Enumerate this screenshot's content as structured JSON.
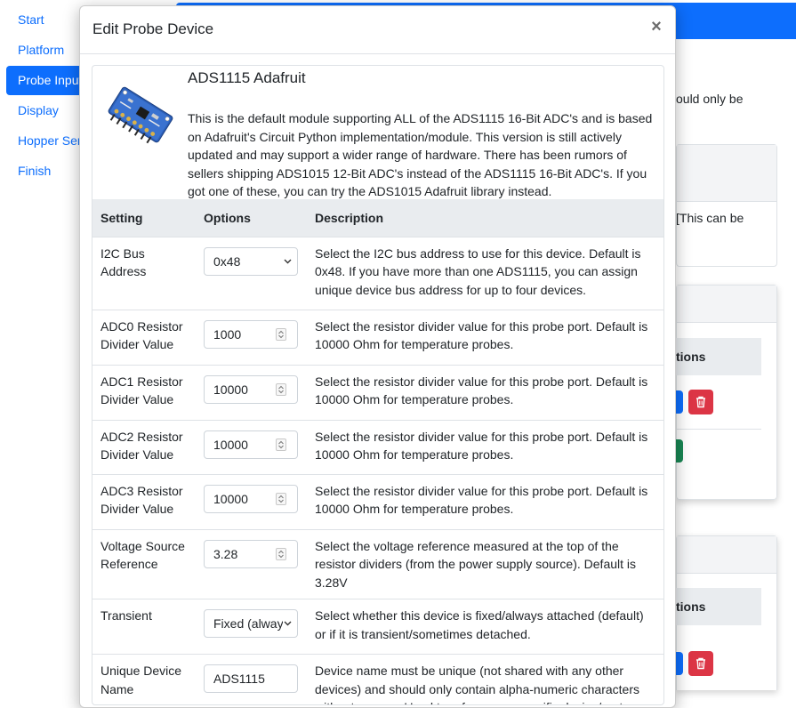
{
  "sidebar": {
    "items": [
      {
        "label": "Start",
        "active": false
      },
      {
        "label": "Platform",
        "active": false
      },
      {
        "label": "Probe Input",
        "active": true
      },
      {
        "label": "Display",
        "active": false
      },
      {
        "label": "Hopper Sensor",
        "active": false
      },
      {
        "label": "Finish",
        "active": false
      }
    ]
  },
  "background": {
    "partial_text_1": "ould only be",
    "partial_text_2": "[This can be",
    "table_header_partial": "tions"
  },
  "modal": {
    "title": "Edit Probe Device",
    "close_glyph": "×",
    "module": {
      "name": "ADS1115 Adafruit",
      "description": "This is the default module supporting ALL of the ADS1115 16-Bit ADC's and is based on Adafruit's Circuit Python implementation/module. This version is still actively updated and may support a wider range of hardware. There has been rumors of sellers shipping ADS1015 12-Bit ADC's instead of the ADS1115 16-Bit ADC's. If you got one of these, you can try the ADS1015 Adafruit library instead."
    },
    "table": {
      "headers": {
        "setting": "Setting",
        "options": "Options",
        "description": "Description"
      },
      "rows": [
        {
          "setting": "I2C Bus Address",
          "value": "0x48",
          "control": "select",
          "description": "Select the I2C bus address to use for this device. Default is 0x48. If you have more than one ADS1115, you can assign unique device bus address for up to four devices."
        },
        {
          "setting": "ADC0 Resistor Divider Value",
          "value": "1000",
          "control": "number",
          "description": "Select the resistor divider value for this probe port. Default is 10000 Ohm for temperature probes."
        },
        {
          "setting": "ADC1 Resistor Divider Value",
          "value": "10000",
          "control": "number",
          "description": "Select the resistor divider value for this probe port. Default is 10000 Ohm for temperature probes."
        },
        {
          "setting": "ADC2 Resistor Divider Value",
          "value": "10000",
          "control": "number",
          "description": "Select the resistor divider value for this probe port. Default is 10000 Ohm for temperature probes."
        },
        {
          "setting": "ADC3 Resistor Divider Value",
          "value": "10000",
          "control": "number",
          "description": "Select the resistor divider value for this probe port. Default is 10000 Ohm for temperature probes."
        },
        {
          "setting": "Voltage Source Reference",
          "value": "3.28",
          "control": "number",
          "description": "Select the voltage reference measured at the top of the resistor dividers (from the power supply source). Default is 3.28V"
        },
        {
          "setting": "Transient",
          "value": "Fixed (always attached)",
          "control": "select",
          "description": "Select whether this device is fixed/always attached (default) or if it is transient/sometimes detached."
        },
        {
          "setting": "Unique Device Name",
          "value": "ADS1115",
          "control": "text",
          "description": "Device name must be unique (not shared with any other devices) and should only contain alpha-numeric characters without spaces. Used to reference a specific device/port."
        }
      ]
    }
  },
  "colors": {
    "primary": "#0d6efd",
    "danger": "#dc3545",
    "success": "#198754",
    "table_header_bg": "#e9ecef",
    "board_blue": "#2b5fb8"
  }
}
